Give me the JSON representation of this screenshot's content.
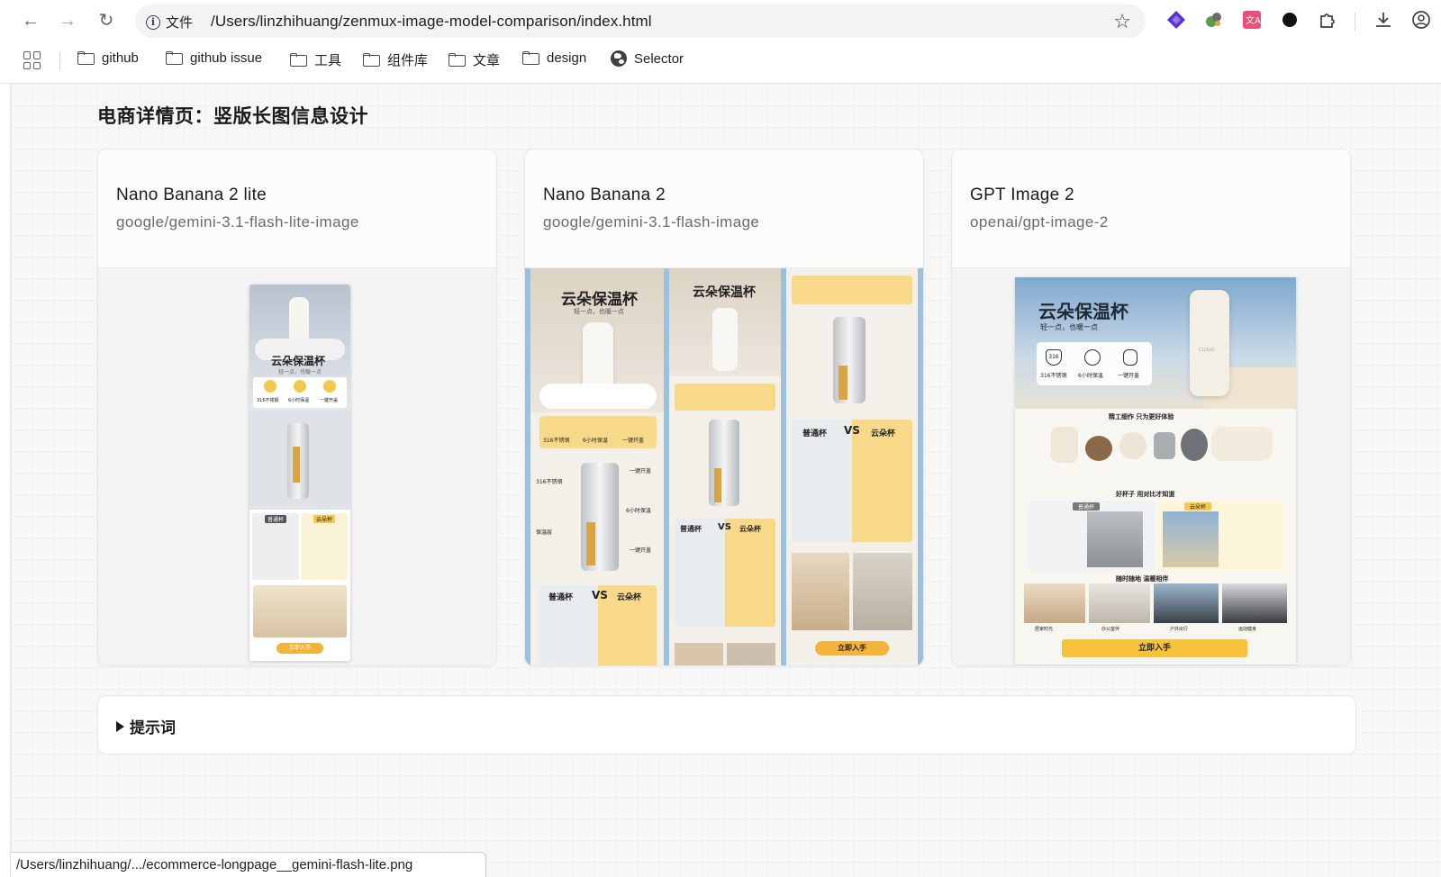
{
  "browser": {
    "url": "/Users/linzhihuang/zenmux-image-model-comparison/index.html",
    "site_label": "文件",
    "bookmarks": [
      "github",
      "github issue",
      "工具",
      "组件库",
      "文章",
      "design",
      "Selector"
    ]
  },
  "section": {
    "title": "电商详情页：竖版长图信息设计"
  },
  "cards": [
    {
      "name": "Nano Banana 2 lite",
      "model_id": "google/gemini-3.1-flash-lite-image",
      "image": {
        "title": "云朵保温杯",
        "subtitle": "轻一点，也暖一点",
        "features": [
          "316不锈钢",
          "6小时保温",
          "一键开盖"
        ],
        "compare_left": "普通杯",
        "compare_right": "云朵杯",
        "cta": "立即入手"
      }
    },
    {
      "name": "Nano Banana 2",
      "model_id": "google/gemini-3.1-flash-image",
      "image": {
        "title": "云朵保温杯",
        "subtitle": "轻一点，也暖一点",
        "features": [
          "316不锈钢",
          "6小时保温",
          "一键开盖"
        ],
        "callouts": [
          "316不锈钢",
          "一键开盖",
          "6小时保温",
          "保温层",
          "一键开盖"
        ],
        "compare_left": "普通杯",
        "compare_vs": "VS",
        "compare_right": "云朵杯",
        "cta": "立即入手"
      }
    },
    {
      "name": "GPT Image 2",
      "model_id": "openai/gpt-image-2",
      "image": {
        "title": "云朵保温杯",
        "subtitle": "轻一点，也暖一点",
        "features": [
          "316不锈钢",
          "6小时保温",
          "一键开盖"
        ],
        "badge": "316",
        "bottle_label": "CLOUD",
        "section1": "精工细作 只为更好体验",
        "section2": "好杯子 用对比才知道",
        "compare_left": "普通杯",
        "compare_right": "云朵杯",
        "section3": "随时随地 温暖相伴",
        "scenes": [
          "居家时光",
          "办公室伴",
          "户外出行",
          "运动健身"
        ],
        "cta": "立即入手"
      }
    }
  ],
  "prompt": {
    "label": "提示词"
  },
  "status_bar": {
    "text": "/Users/linzhihuang/.../ecommerce-longpage__gemini-flash-lite.png"
  },
  "colors": {
    "accent_yellow": "#f6c23b",
    "sky_blue": "#9cc1de",
    "panel_beige": "#ece4d6"
  }
}
